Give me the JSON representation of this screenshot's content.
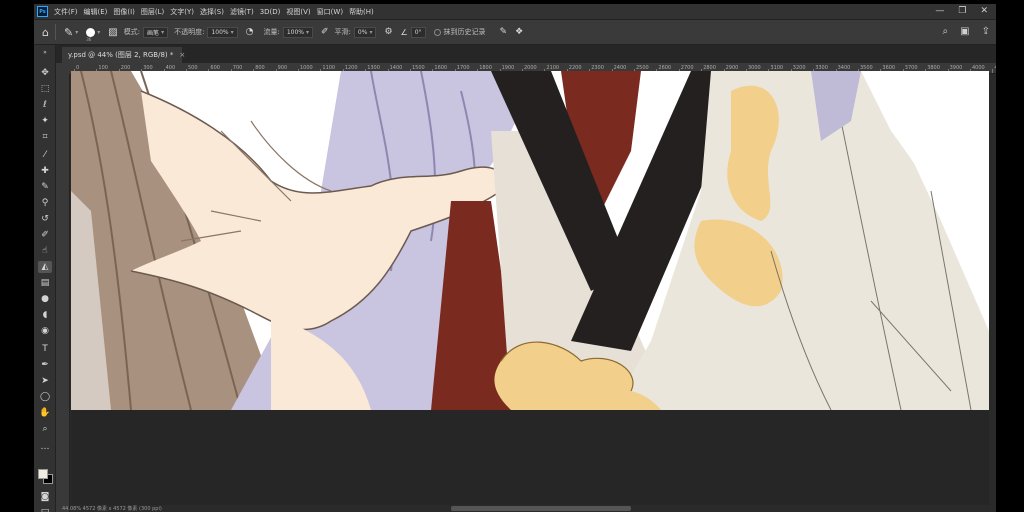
{
  "menubar": {
    "logo_text": "Ps",
    "items": [
      "文件(F)",
      "编辑(E)",
      "图像(I)",
      "图层(L)",
      "文字(Y)",
      "选择(S)",
      "滤镜(T)",
      "3D(D)",
      "视图(V)",
      "窗口(W)",
      "帮助(H)"
    ],
    "window_controls": [
      "—",
      "❐",
      "✕"
    ]
  },
  "options_bar": {
    "brush_size": "36",
    "mode_label": "模式:",
    "mode_value": "画笔",
    "opacity_label": "不透明度:",
    "opacity_value": "100%",
    "flow_label": "流量:",
    "flow_value": "100%",
    "smooth_label": "平滑:",
    "smooth_value": "0%",
    "angle_value": "0°",
    "erase_history_label": "抹到历史记录"
  },
  "document_tab": {
    "title": "y.psd @ 44% (图层 2, RGB/8) *",
    "close": "×"
  },
  "ruler_labels": [
    "0",
    "100",
    "200",
    "300",
    "400",
    "500",
    "600",
    "700",
    "800",
    "900",
    "1000",
    "1100",
    "1200",
    "1300",
    "1400",
    "1500",
    "1600",
    "1700",
    "1800",
    "1900",
    "2000",
    "2100",
    "2200",
    "2300",
    "2400",
    "2500",
    "2600",
    "2700",
    "2800",
    "2900",
    "3000",
    "3100",
    "3200",
    "3300",
    "3400",
    "3500",
    "3600",
    "3700",
    "3800",
    "3900",
    "4000",
    "410"
  ],
  "status": {
    "text": "44.08%   4572 像素 x 4572 像素 (300 ppi)"
  },
  "colors": {
    "foreground": "#f0ecdf",
    "background": "#000000"
  }
}
